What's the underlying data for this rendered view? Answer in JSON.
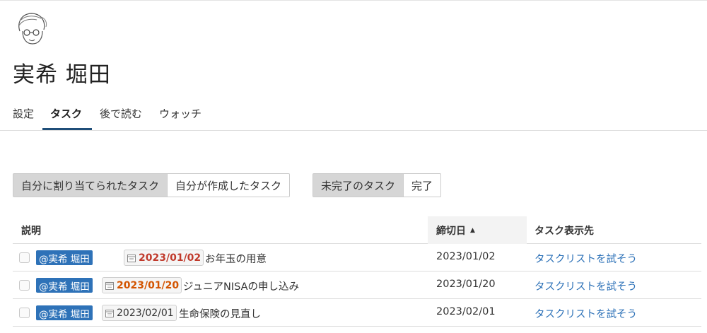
{
  "user": {
    "avatar_icon": "user-avatar-illustration",
    "name": "実希 堀田"
  },
  "tabs": [
    {
      "label": "設定",
      "active": false
    },
    {
      "label": "タスク",
      "active": true
    },
    {
      "label": "後で読む",
      "active": false
    },
    {
      "label": "ウォッチ",
      "active": false
    }
  ],
  "filters": {
    "assignment": [
      "自分に割り当てられたタスク",
      "自分が作成したタスク"
    ],
    "assignment_active": "自分に割り当てられたタスク",
    "status": [
      "未完了のタスク",
      "完了"
    ],
    "status_active": "未完了のタスク"
  },
  "table": {
    "columns": [
      "説明",
      "締切日",
      "タスク表示先"
    ],
    "sort_column": "締切日",
    "sort_direction": "ascending",
    "rows": [
      {
        "mention": "@実希 堀田",
        "date_chip": "2023/01/02",
        "date_state": "overdue",
        "description": "お年玉の用意",
        "due": "2023/01/02",
        "target": "タスクリストを試そう"
      },
      {
        "mention": "@実希 堀田",
        "date_chip": "2023/01/20",
        "date_state": "due-soon",
        "description": "ジュニアNISAの申し込み",
        "due": "2023/01/20",
        "target": "タスクリストを試そう"
      },
      {
        "mention": "@実希 堀田",
        "date_chip": "2023/02/01",
        "date_state": "normal",
        "description": "生命保険の見直し",
        "due": "2023/02/01",
        "target": "タスクリストを試そう"
      }
    ]
  },
  "colors": {
    "accent": "#2e72b8",
    "tab_underline": "#1f4e79",
    "overdue": "#c0392b",
    "due_soon": "#d35400"
  }
}
